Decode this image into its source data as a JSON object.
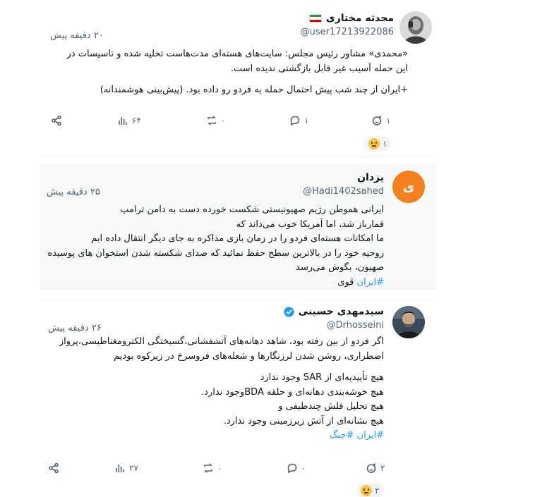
{
  "posts": [
    {
      "name": "محدثه مختاری",
      "handle": "@user17213922086",
      "time": "۲۰ دقیقه پیش",
      "lines": [
        "«محمدی» مشاور رئیس مجلس: سایت‌های هسته‌ای مدت‌هاست تخلیه شده و تاسیسات در",
        "این حمله آسیب غیر قابل بازگشتی ندیده است.",
        "",
        "+ایران از چند شب پیش احتمال حمله به فردو رو داده بود. (پیش‌بینی هوشمندانه)"
      ],
      "actions": {
        "likes": "۱",
        "comments": "۱",
        "reposts": "۰",
        "views": "۶۴"
      },
      "reaction_count": "۱"
    },
    {
      "name": "یزدان",
      "handle": "@Hadi1402sahed",
      "avatar_letter": "ی",
      "time": "۲۵ دقیقه پیش",
      "lines": [
        "ایرانی هموطن رژیم صهیونیستی شکست خورده دست به دامن ترامپ",
        "قمارباز شد، اما آمریکا خوب می‌داند که",
        "ما امکانات هسته‌ای فردو را در زمان بازی مذاکره به جای دیگر انتقال داده ایم",
        "روحیه خود را در بالاترین سطح حفظ نمائید که صدای شکسته شدن استخوان های پوسیده",
        "صهیون، بگوش می‌رسد"
      ],
      "hashtag": "#ایران",
      "hashtag_tail": " قوی"
    },
    {
      "name": "سیدمهدی حسینی",
      "handle": "@Drhosseini",
      "time": "۲۶ دقیقه پیش",
      "lines": [
        "اگر فردو از بین رفته بود، شاهد دهانه‌های آتشفشانی،گسیختگی الکترومغناطیسی،پرواز",
        "اضطراری، روشن شدن لرزنگارها و شعله‌های فروسرخ در زیرکوه بودیم",
        "",
        "هیچ تأییدیه‌ای از SAR وجود ندارد",
        "هیچ خوشه‌بندی دهانه‌ای و حلقه BDAوجود ندارد.",
        "هیچ تحلیل فلش چندطیفی و",
        "هیچ نشانه‌ای از آتش زیرزمینی وجود ندارد."
      ],
      "hashtags": [
        "#ایران",
        "#جنگ"
      ],
      "actions": {
        "likes": "۲",
        "comments": "۰",
        "reposts": "۰",
        "views": "۲۷"
      },
      "reaction_count": "۲"
    }
  ],
  "colors": {
    "accent": "#1d9bf0",
    "muted": "#536471",
    "avatar_orange": "#f4801f",
    "verified": "#1d9bf0"
  },
  "icons": [
    "share-icon",
    "views-icon",
    "repost-icon",
    "comment-icon",
    "add-reaction-icon",
    "verified-icon",
    "iran-flag-icon",
    "thinking-emoji-icon",
    "thumbs-up-emoji-icon"
  ]
}
